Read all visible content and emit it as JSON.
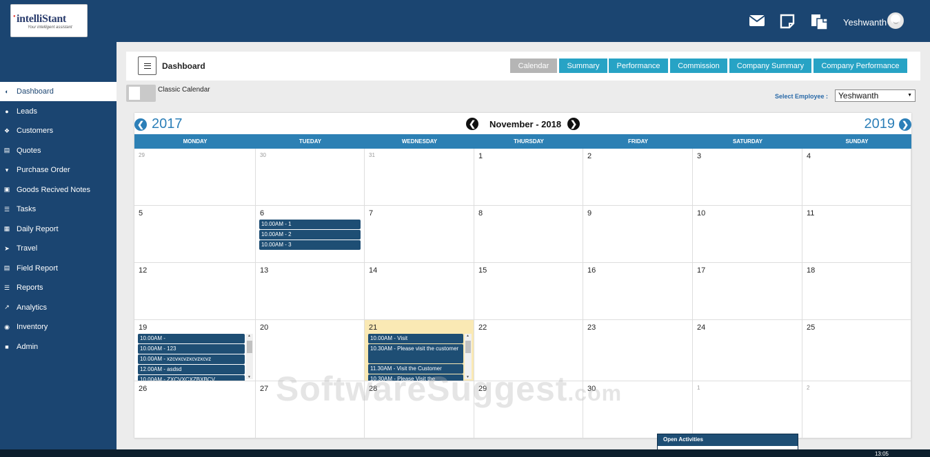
{
  "app": {
    "logo_text": "intelliStant",
    "logo_tagline": "Your intelligent assistant",
    "user_name": "Yeshwanth"
  },
  "sidebar": {
    "items": [
      {
        "label": "Dashboard",
        "icon": "dashboard-icon",
        "active": true
      },
      {
        "label": "Leads",
        "icon": "user-icon"
      },
      {
        "label": "Customers",
        "icon": "users-icon"
      },
      {
        "label": "Quotes",
        "icon": "document-icon"
      },
      {
        "label": "Purchase Order",
        "icon": "cart-icon"
      },
      {
        "label": "Goods Recived Notes",
        "icon": "notes-icon"
      },
      {
        "label": "Tasks",
        "icon": "tasks-icon"
      },
      {
        "label": "Daily Report",
        "icon": "calendar-icon"
      },
      {
        "label": "Travel",
        "icon": "travel-icon"
      },
      {
        "label": "Field Report",
        "icon": "report-icon"
      },
      {
        "label": "Reports",
        "icon": "list-icon"
      },
      {
        "label": "Analytics",
        "icon": "analytics-icon"
      },
      {
        "label": "Inventory",
        "icon": "inventory-icon"
      },
      {
        "label": "Admin",
        "icon": "lock-icon"
      }
    ]
  },
  "header": {
    "title": "Dashboard",
    "tabs": [
      "Calendar",
      "Summary",
      "Performance",
      "Commission",
      "Company Summary",
      "Company Performance"
    ]
  },
  "toggle_label": "Classic Calendar",
  "employee": {
    "label": "Select Employee :",
    "value": "Yeshwanth"
  },
  "calendar": {
    "prev_year": "2017",
    "next_year": "2019",
    "month_label": "November - 2018",
    "weekdays": [
      "MONDAY",
      "TUEDAY",
      "WEDNESDAY",
      "THURSDAY",
      "FRIDAY",
      "SATURDAY",
      "SUNDAY"
    ],
    "weeks": [
      [
        {
          "d": "29",
          "other": true
        },
        {
          "d": "30",
          "other": true
        },
        {
          "d": "31",
          "other": true
        },
        {
          "d": "1"
        },
        {
          "d": "2"
        },
        {
          "d": "3"
        },
        {
          "d": "4"
        }
      ],
      [
        {
          "d": "5"
        },
        {
          "d": "6",
          "events": [
            "10.00AM - 1",
            "10.00AM - 2",
            "10.00AM - 3"
          ]
        },
        {
          "d": "7"
        },
        {
          "d": "8"
        },
        {
          "d": "9"
        },
        {
          "d": "10"
        },
        {
          "d": "11"
        }
      ],
      [
        {
          "d": "12"
        },
        {
          "d": "13"
        },
        {
          "d": "14"
        },
        {
          "d": "15"
        },
        {
          "d": "16"
        },
        {
          "d": "17"
        },
        {
          "d": "18"
        }
      ],
      [
        {
          "d": "19",
          "scroll": true,
          "events": [
            "10.00AM -",
            "10.00AM - 123",
            "10.00AM - xzcvxcvzxcvzxcvz",
            "12.00AM - asdsd",
            "10.00AM - ZXCVXCXZBXBCV"
          ]
        },
        {
          "d": "20"
        },
        {
          "d": "21",
          "today": true,
          "scroll": true,
          "events": [
            "10.00AM - Visit",
            "10.30AM - Please visit the customer",
            "11.30AM - Visit the Customer",
            "10.30AM - Please Visit the"
          ]
        },
        {
          "d": "22"
        },
        {
          "d": "23"
        },
        {
          "d": "24"
        },
        {
          "d": "25"
        }
      ],
      [
        {
          "d": "26"
        },
        {
          "d": "27"
        },
        {
          "d": "28"
        },
        {
          "d": "29"
        },
        {
          "d": "30"
        },
        {
          "d": "1",
          "other": true
        },
        {
          "d": "2",
          "other": true
        }
      ]
    ]
  },
  "open_activities": "Open Activities",
  "watermark": "SoftwareSuggest",
  "watermark_suffix": ".com",
  "taskbar_time": "13:05",
  "colors": {
    "brand": "#1b4571",
    "accent": "#27a3c5",
    "header": "#2c80b4",
    "event": "#1e4e74",
    "today": "#fae9b4"
  }
}
